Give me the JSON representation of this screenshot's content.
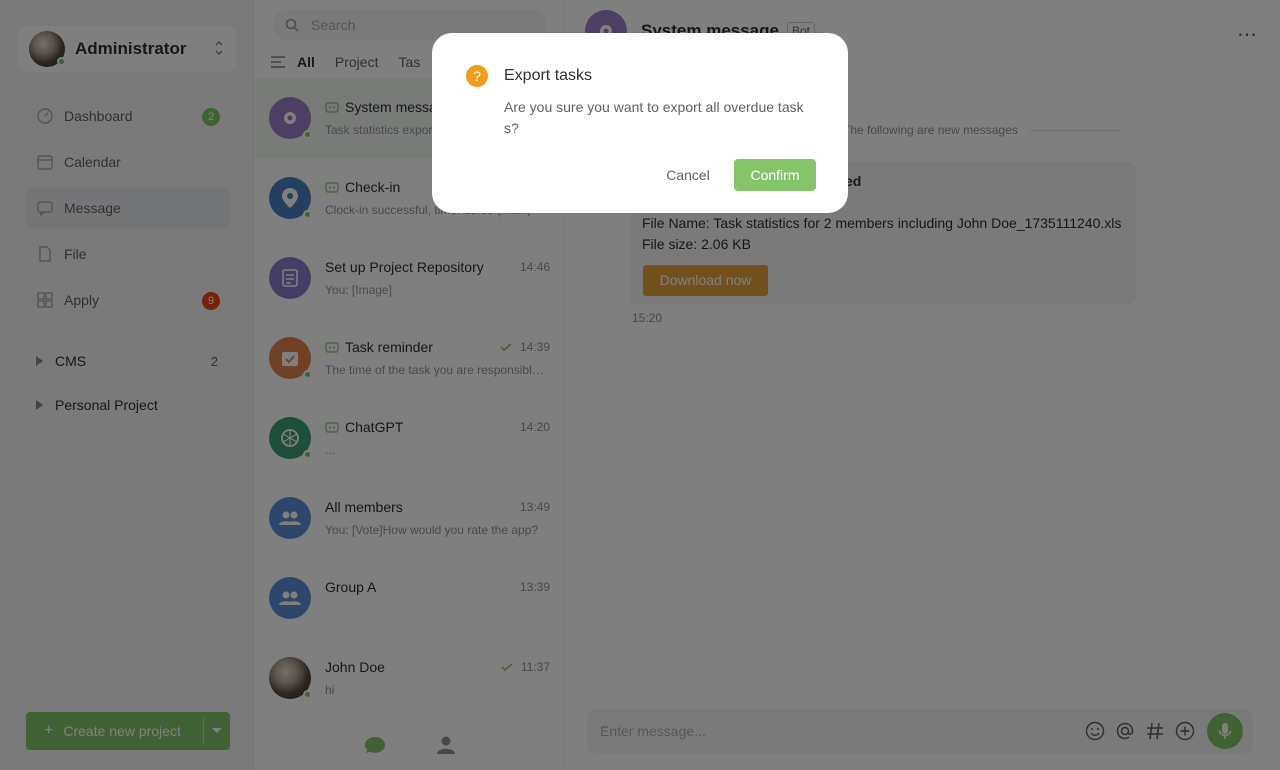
{
  "colors": {
    "accent": "#84c56a",
    "badge_red": "#ed4014",
    "warning": "#f29d1a",
    "download": "#e6a23c"
  },
  "user": {
    "name": "Administrator",
    "status": "online"
  },
  "nav": [
    {
      "label": "Dashboard",
      "badge": "2",
      "icon": "dashboard-icon"
    },
    {
      "label": "Calendar",
      "badge": "",
      "icon": "calendar-icon"
    },
    {
      "label": "Message",
      "badge": "",
      "icon": "message-icon"
    },
    {
      "label": "File",
      "badge": "",
      "icon": "file-icon"
    },
    {
      "label": "Apply",
      "badge": "9",
      "icon": "apply-icon"
    }
  ],
  "projects": [
    {
      "label": "CMS",
      "count": "2"
    },
    {
      "label": "Personal Project",
      "count": ""
    }
  ],
  "create_button": {
    "label": "Create new project"
  },
  "search": {
    "placeholder": "Search"
  },
  "tabs": [
    "All",
    "Project",
    "Tas"
  ],
  "chats": [
    {
      "title": "System message",
      "time": "",
      "preview": "Task statistics export completed",
      "icon": "gear-icon"
    },
    {
      "title": "Check-in",
      "time": "",
      "preview": "Clock-in successful, time: 15:00 (Main)",
      "icon": "location-pin-icon"
    },
    {
      "title": "Set up Project Repository",
      "time": "14:46",
      "preview": "You: [Image]",
      "icon": "task-list-icon"
    },
    {
      "title": "Task reminder",
      "time": "14:39",
      "preview": "The time of the task you are responsible for is coming",
      "icon": "calendar-check-icon"
    },
    {
      "title": "ChatGPT",
      "time": "14:20",
      "preview": "...",
      "icon": "openai-icon"
    },
    {
      "title": "All members",
      "time": "13:49",
      "preview": "You: [Vote]How would you rate the app?",
      "icon": "group-icon"
    },
    {
      "title": "Group A",
      "time": "13:39",
      "preview": "",
      "icon": "group-icon"
    },
    {
      "title": "John Doe",
      "time": "11:37",
      "preview": "hi",
      "icon": "avatar"
    }
  ],
  "panel": {
    "title": "System message",
    "tag": "Bot",
    "divider": "The following are new messages",
    "message": {
      "heading": "ed",
      "file_name": "File Name: Task statistics for 2 members including John Doe_1735111240.xls",
      "file_size": "File size: 2.06 KB",
      "download_label": "Download now",
      "time": "15:20"
    },
    "input_placeholder": "Enter message..."
  },
  "dialog": {
    "icon_text": "?",
    "title": "Export tasks",
    "body": "Are you sure you want to export all overdue tasks?",
    "cancel_label": "Cancel",
    "confirm_label": "Confirm"
  }
}
